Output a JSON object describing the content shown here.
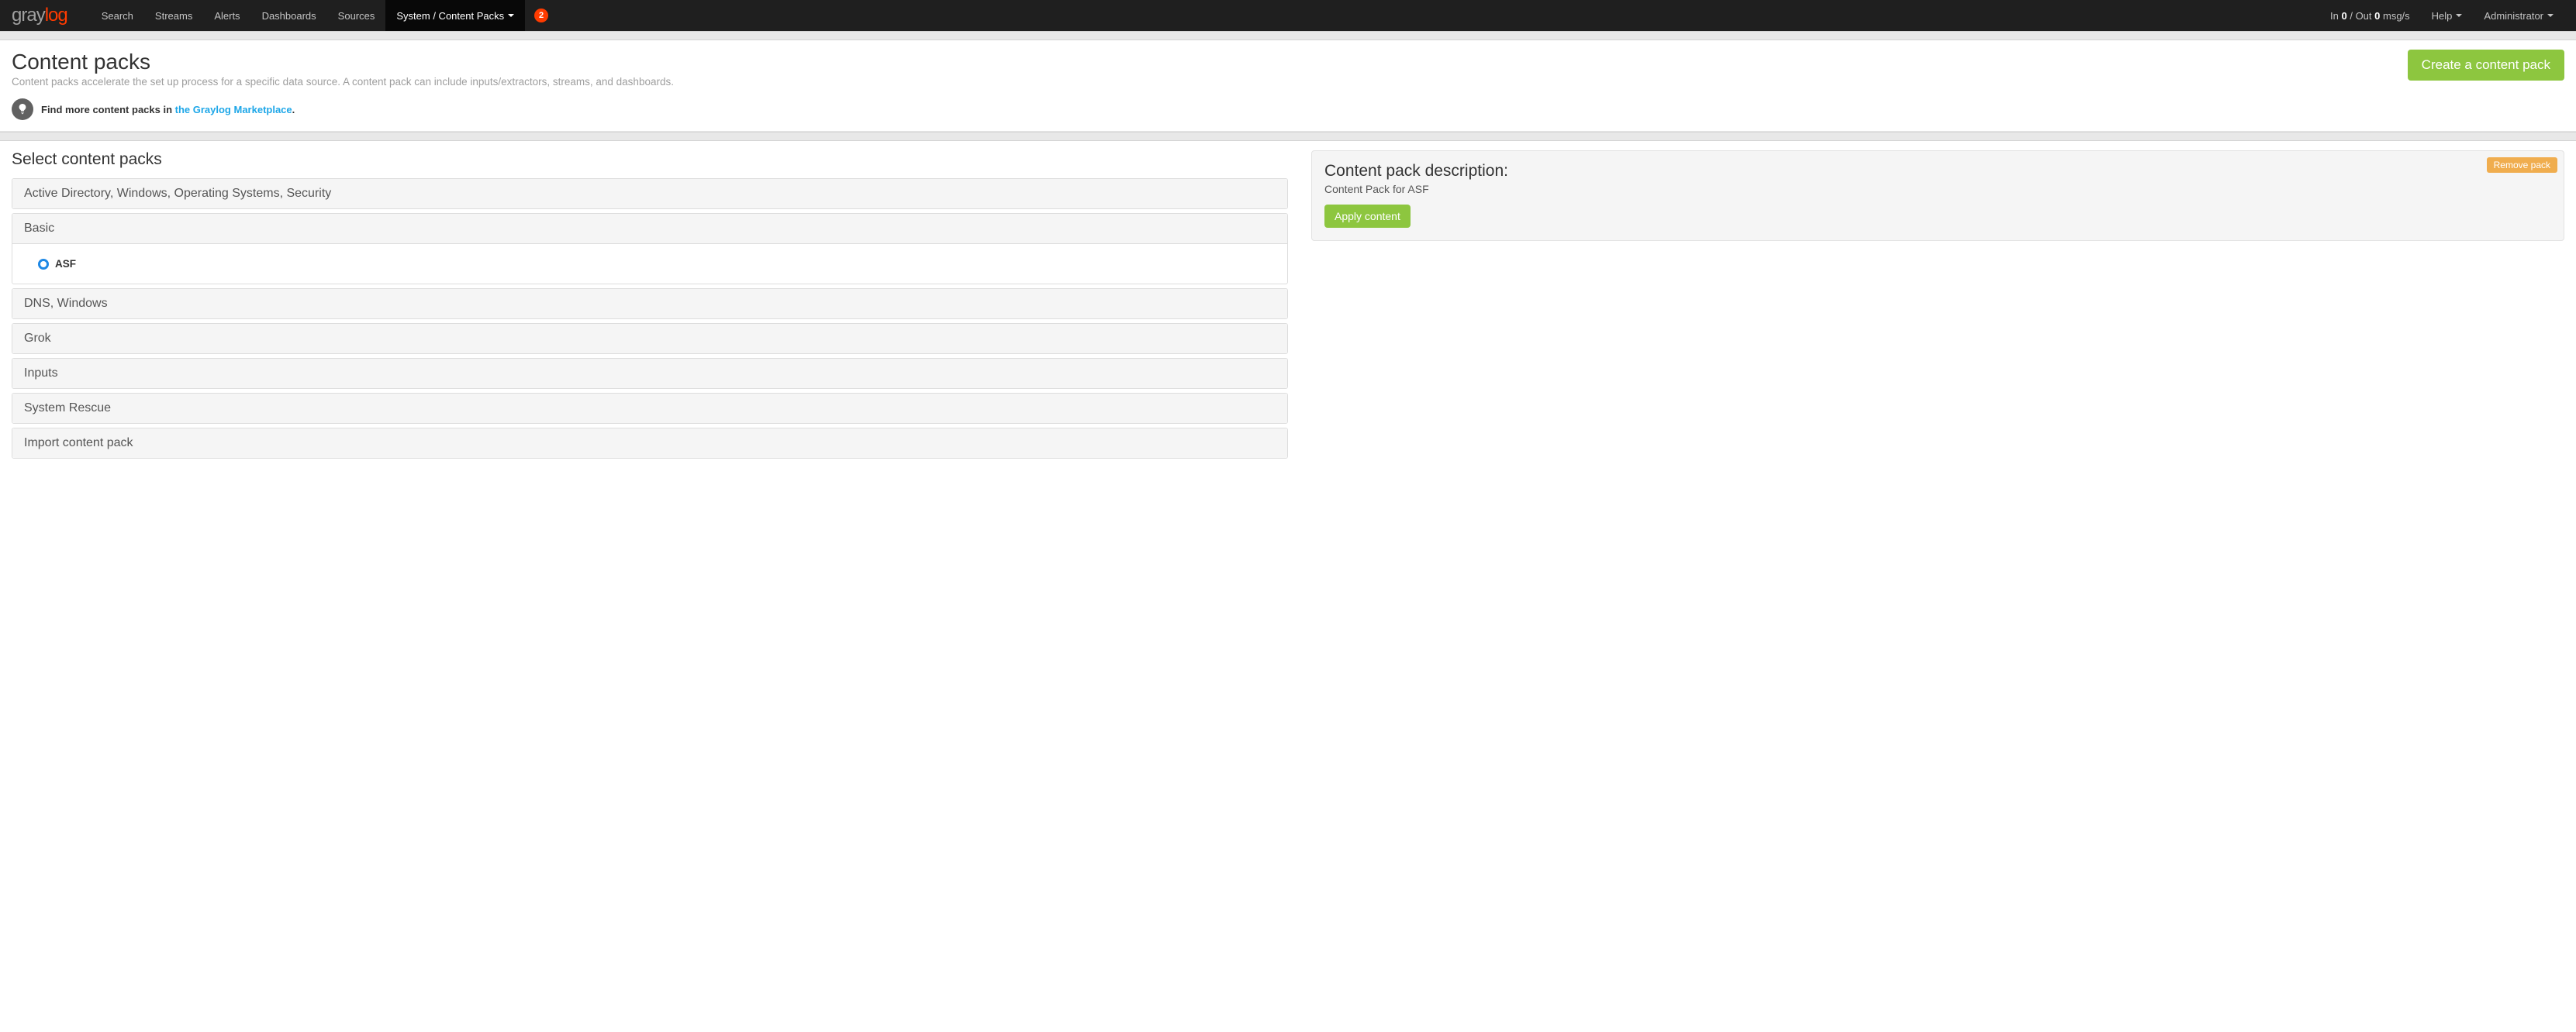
{
  "nav": {
    "items": [
      "Search",
      "Streams",
      "Alerts",
      "Dashboards",
      "Sources",
      "System / Content Packs"
    ],
    "active_index": 5,
    "notif_count": "2",
    "io_prefix": "In ",
    "io_in": "0",
    "io_mid": " / Out ",
    "io_out": "0",
    "io_suffix": " msg/s",
    "help": "Help",
    "admin": "Administrator"
  },
  "header": {
    "title": "Content packs",
    "subtitle": "Content packs accelerate the set up process for a specific data source. A content pack can include inputs/extractors, streams, and dashboards.",
    "hint_prefix": "Find more content packs in ",
    "hint_link": "the Graylog Marketplace",
    "hint_suffix": ".",
    "create_btn": "Create a content pack"
  },
  "select": {
    "title": "Select content packs",
    "groups": [
      {
        "label": "Active Directory, Windows, Operating Systems, Security",
        "expanded": false
      },
      {
        "label": "Basic",
        "expanded": true,
        "items": [
          {
            "name": "ASF"
          }
        ]
      },
      {
        "label": "DNS, Windows",
        "expanded": false
      },
      {
        "label": "Grok",
        "expanded": false
      },
      {
        "label": "Inputs",
        "expanded": false
      },
      {
        "label": "System Rescue",
        "expanded": false
      },
      {
        "label": "Import content pack",
        "expanded": false
      }
    ]
  },
  "description": {
    "title": "Content pack description:",
    "text": "Content Pack for ASF",
    "apply": "Apply content",
    "remove": "Remove pack"
  }
}
